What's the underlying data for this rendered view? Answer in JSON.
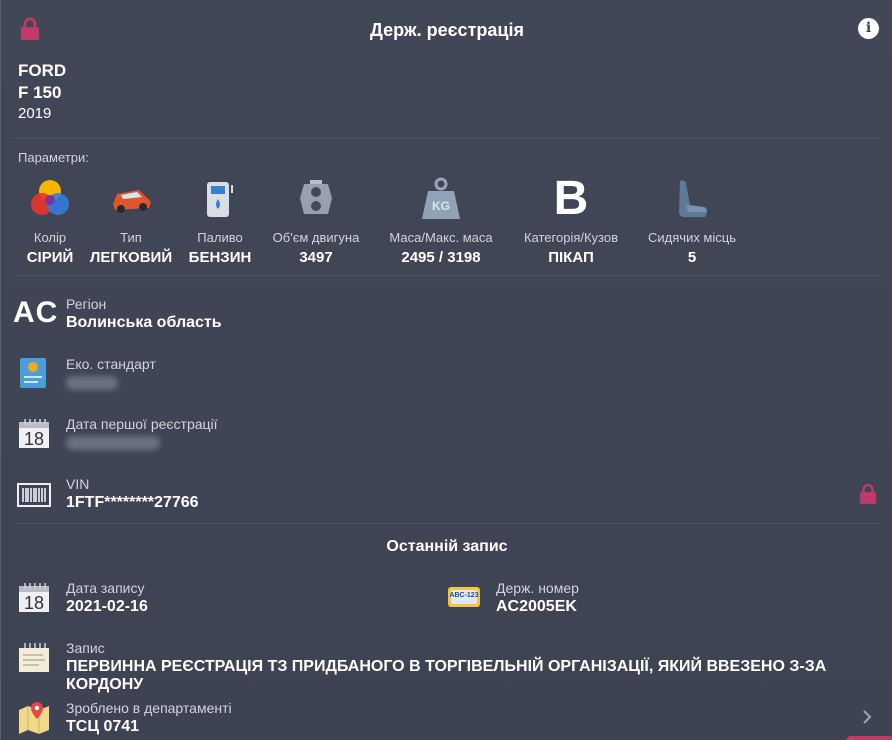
{
  "header": {
    "title": "Держ. реєстрація",
    "info_icon": "info-icon",
    "lock_icon": "lock-icon"
  },
  "vehicle": {
    "make": "FORD",
    "model": "F 150",
    "year": "2019"
  },
  "params": {
    "label": "Параметри:",
    "items": [
      {
        "label": "Колір",
        "value": "СІРИЙ",
        "icon": "color-palette-icon"
      },
      {
        "label": "Тип",
        "value": "ЛЕГКОВИЙ",
        "icon": "car-icon"
      },
      {
        "label": "Паливо",
        "value": "БЕНЗИН",
        "icon": "fuel-pump-icon"
      },
      {
        "label": "Об'єм двигуна",
        "value": "3497",
        "icon": "engine-icon"
      },
      {
        "label": "Маса/Макс. маса",
        "value": "2495 / 3198",
        "icon": "weight-icon"
      },
      {
        "label": "Категорія/Кузов",
        "value": "ПІКАП",
        "icon_letter": "B"
      },
      {
        "label": "Сидячих місць",
        "value": "5",
        "icon": "seat-icon"
      }
    ]
  },
  "region": {
    "code": "AC",
    "label": "Регіон",
    "value": "Волинська область"
  },
  "eco": {
    "label": "Еко. стандарт"
  },
  "first_reg": {
    "label": "Дата першої реєстрації",
    "calendar_day": "18"
  },
  "vin": {
    "label": "VIN",
    "value": "1FTF********27766"
  },
  "last_record": {
    "title": "Останній запис",
    "date_label": "Дата запису",
    "date_value": "2021-02-16",
    "calendar_day": "18",
    "plate_label": "Держ. номер",
    "plate_value": "AC2005EK",
    "plate_icon_text": "ABC-123",
    "record_label": "Запис",
    "record_value": "ПЕРВИННА РЕЄСТРАЦІЯ ТЗ ПРИДБАНОГО В ТОРГІВЕЛЬНІЙ ОРГАНІЗАЦІЇ, ЯКИЙ ВВЕЗЕНО З-ЗА КОРДОНУ",
    "dept_label": "Зроблено в департаменті",
    "dept_value": "ТСЦ 0741"
  },
  "colors": {
    "background": "#3f4554",
    "accent": "#c23a6a",
    "muted_text": "#d0d4dc"
  }
}
